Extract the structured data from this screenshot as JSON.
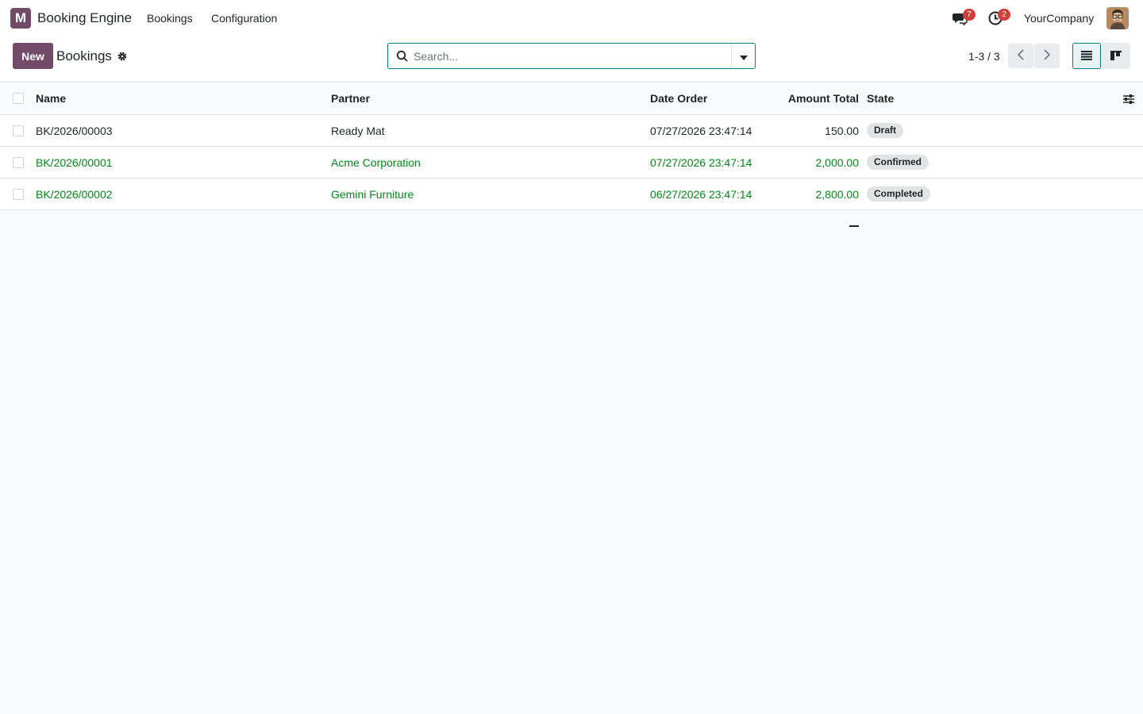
{
  "navbar": {
    "logo_letter": "M",
    "app_name": "Booking Engine",
    "menu": [
      "Bookings",
      "Configuration"
    ],
    "messages_count": "7",
    "activities_count": "2",
    "company": "YourCompany"
  },
  "control": {
    "new_label": "New",
    "title": "Bookings",
    "search_placeholder": "Search...",
    "pager": "1-3 / 3"
  },
  "table": {
    "columns": [
      "Name",
      "Partner",
      "Date Order",
      "Amount Total",
      "State"
    ],
    "rows": [
      {
        "name": "BK/2026/00003",
        "partner": "Ready Mat",
        "date": "07/27/2026 23:47:14",
        "amount": "150.00",
        "state": "Draft"
      },
      {
        "name": "BK/2026/00001",
        "partner": "Acme Corporation",
        "date": "07/27/2026 23:47:14",
        "amount": "2,000.00",
        "state": "Confirmed"
      },
      {
        "name": "BK/2026/00002",
        "partner": "Gemini Furniture",
        "date": "06/27/2026 23:47:14",
        "amount": "2,800.00",
        "state": "Completed"
      }
    ]
  },
  "colors": {
    "brand": "#714b67",
    "accent": "#017e84",
    "success_text": "#008818",
    "badge": "#d23f3a"
  }
}
